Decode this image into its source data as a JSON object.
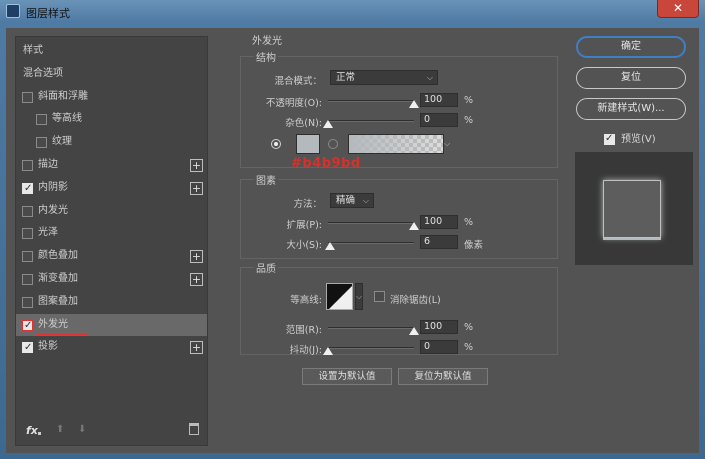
{
  "window": {
    "title": "图层样式",
    "close": "✕"
  },
  "left_panel": {
    "items": [
      {
        "label": "样式",
        "checkbox": false
      },
      {
        "label": "混合选项",
        "checkbox": false
      },
      {
        "label": "斜面和浮雕",
        "checkbox": true,
        "checked": false
      },
      {
        "label": "等高线",
        "checkbox": true,
        "checked": false,
        "indent": true
      },
      {
        "label": "纹理",
        "checkbox": true,
        "checked": false,
        "indent": true
      },
      {
        "label": "描边",
        "checkbox": true,
        "checked": false,
        "plus": true
      },
      {
        "label": "内阴影",
        "checkbox": true,
        "checked": true,
        "plus": true
      },
      {
        "label": "内发光",
        "checkbox": true,
        "checked": false
      },
      {
        "label": "光泽",
        "checkbox": true,
        "checked": false
      },
      {
        "label": "颜色叠加",
        "checkbox": true,
        "checked": false,
        "plus": true
      },
      {
        "label": "渐变叠加",
        "checkbox": true,
        "checked": false,
        "plus": true
      },
      {
        "label": "图案叠加",
        "checkbox": true,
        "checked": false
      },
      {
        "label": "外发光",
        "checkbox": true,
        "checked": true,
        "selected": true
      },
      {
        "label": "投影",
        "checkbox": true,
        "checked": true,
        "plus": true
      }
    ],
    "footer": {
      "fx": "fx",
      "up": "⬆",
      "down": "⬇",
      "trash_icon": "trash-icon"
    }
  },
  "outer_glow": {
    "section_title": "外发光",
    "structure": {
      "title": "结构",
      "blend_mode_label": "混合模式：",
      "blend_mode_value": "正常",
      "opacity_label": "不透明度(O):",
      "opacity_value": "100",
      "opacity_fraction": 1.0,
      "noise_label": "杂色(N):",
      "noise_value": "0",
      "noise_fraction": 0.0,
      "percent": "%",
      "color_hex": "#b4b9bd",
      "swatch_color": "#b4b9bd",
      "hex_note_color": "#d8302a"
    },
    "elements": {
      "title": "图素",
      "method_label": "方法：",
      "method_value": "精确",
      "spread_label": "扩展(P):",
      "spread_value": "100",
      "spread_fraction": 1.0,
      "size_label": "大小(S):",
      "size_value": "6",
      "size_fraction": 0.024,
      "percent": "%",
      "pixels": "像素"
    },
    "quality": {
      "title": "品质",
      "contour_label": "等高线:",
      "antialias_label": "消除锯齿(L)",
      "range_label": "范围(R):",
      "range_value": "100",
      "range_fraction": 1.0,
      "jitter_label": "抖动(J):",
      "jitter_value": "0",
      "jitter_fraction": 0.0,
      "percent": "%"
    },
    "set_default": "设置为默认值",
    "reset_default": "复位为默认值"
  },
  "right_panel": {
    "ok": "确定",
    "reset": "复位",
    "new_style": "新建样式(W)...",
    "preview_label": "预览(V)",
    "accent": "#3f7fc4"
  }
}
